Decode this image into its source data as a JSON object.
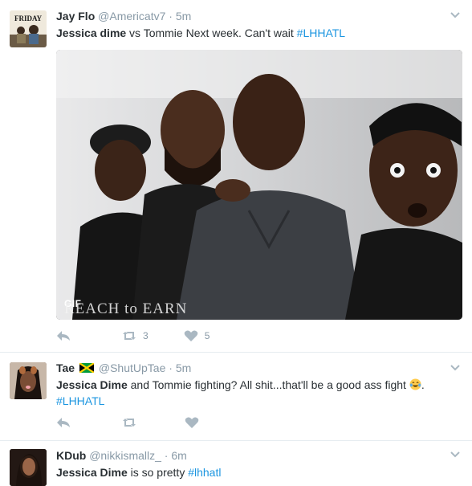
{
  "tweets": [
    {
      "name": "Jay Flo",
      "handle": "@Americatv7",
      "separator": "·",
      "time": "5m",
      "text_bold": "Jessica dime",
      "text_rest": " vs Tommie Next week. Can't wait ",
      "hashtag": "#LHHATL",
      "avatar_label": "FRIDAY",
      "media": {
        "type": "gif",
        "badge": "GIF",
        "watermark": "REACH to EARN"
      },
      "retweets": "3",
      "likes": "5"
    },
    {
      "name": "Tae",
      "handle": "@ShutUpTae",
      "separator": "·",
      "time": "5m",
      "text_bold": "Jessica Dime",
      "text_rest": " and Tommie fighting? All shit...that'll be a good ass fight ",
      "text_after_emoji": ".",
      "hashtag": "#LHHATL",
      "flag_icon": "jamaica-flag-icon",
      "emoji_icon": "tears-of-joy-emoji-icon",
      "retweets": "",
      "likes": ""
    },
    {
      "name": "KDub",
      "handle": "@nikkismallz_",
      "separator": "·",
      "time": "6m",
      "text_bold": "Jessica Dime",
      "text_rest": " is so pretty ",
      "hashtag": "#lhhatl"
    }
  ],
  "icons": {
    "reply": "reply-icon",
    "retweet": "retweet-icon",
    "like": "heart-icon",
    "menu": "chevron-down-icon"
  },
  "colors": {
    "link": "#1b95e0",
    "muted": "#8899a6",
    "action": "#aab8c2",
    "text": "#292f33",
    "divider": "#e6ecf0"
  }
}
